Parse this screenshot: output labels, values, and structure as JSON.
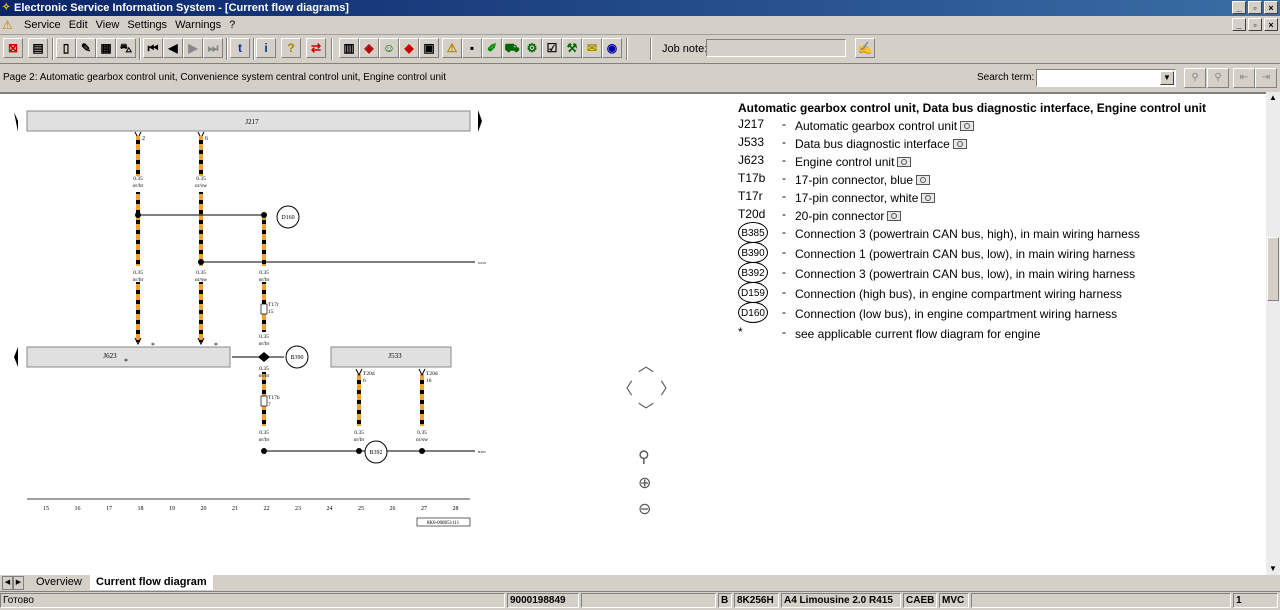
{
  "window": {
    "title": "Electronic Service Information System - [Current flow diagrams]",
    "buttons": [
      "_",
      "▫",
      "×"
    ]
  },
  "menu": {
    "items": [
      "Service",
      "Edit",
      "View",
      "Settings",
      "Warnings",
      "?"
    ]
  },
  "toolbar": {
    "job_note_label": "Job note:",
    "job_note_value": ""
  },
  "pagebar": {
    "page_text": "Page 2: Automatic gearbox control unit, Convenience system central control unit, Engine control unit",
    "search_label": "Search term:",
    "search_value": ""
  },
  "legend": {
    "heading": "Automatic gearbox control unit, Data bus diagnostic interface, Engine control unit",
    "rows": [
      {
        "code": "J217",
        "desc": "Automatic gearbox control unit",
        "photo": true
      },
      {
        "code": "J533",
        "desc": "Data bus diagnostic interface",
        "photo": true
      },
      {
        "code": "J623",
        "desc": "Engine control unit",
        "photo": true
      },
      {
        "code": "T17b",
        "desc": "17-pin connector, blue",
        "photo": true
      },
      {
        "code": "T17r",
        "desc": "17-pin connector, white",
        "photo": true
      },
      {
        "code": "T20d",
        "desc": "20-pin connector",
        "photo": true
      },
      {
        "code": "B385",
        "desc": "Connection 3 (powertrain CAN bus, high), in main wiring harness",
        "circle": true
      },
      {
        "code": "B390",
        "desc": "Connection 1 (powertrain CAN bus, low), in main wiring harness",
        "circle": true
      },
      {
        "code": "B392",
        "desc": "Connection 3 (powertrain CAN bus, low), in main wiring harness",
        "circle": true
      },
      {
        "code": "D159",
        "desc": "Connection (high bus), in engine compartment wiring harness",
        "circle": true
      },
      {
        "code": "D160",
        "desc": "Connection (low bus), in engine compartment wiring harness",
        "circle": true
      },
      {
        "code": "*",
        "desc": "see applicable current flow diagram for engine"
      }
    ]
  },
  "diagram": {
    "component_j217": "J217",
    "component_j623": "J623",
    "component_j533": "J533",
    "pin_2": "2",
    "pin_6": "6",
    "wire_gauge": "0.35",
    "wire_color_or_br": "or/br",
    "wire_color_or_sw": "or/sw",
    "conn_d160": "D160",
    "conn_b390": "B390",
    "conn_b392": "B392",
    "conn_t17r": "T17r",
    "conn_t17r_pin": "15",
    "conn_t17b": "T17b",
    "conn_t17b_pin": "7",
    "conn_t20d_a": "T20d",
    "conn_t20d_a_pin": "6",
    "conn_t20d_b": "T20d",
    "conn_t20d_b_pin": "16",
    "ref_d159": "D159",
    "ref_b385": "B385",
    "star": "*",
    "drawing_id": "8K0-008051111",
    "grid_numbers": [
      "15",
      "16",
      "17",
      "18",
      "19",
      "20",
      "21",
      "22",
      "23",
      "24",
      "25",
      "26",
      "27",
      "28"
    ]
  },
  "tabs": {
    "overview": "Overview",
    "current": "Current flow diagram"
  },
  "status": {
    "ready": "Готово",
    "order": "9000198849",
    "b": "B",
    "model_code": "8K256H",
    "model": "A4 Limousine 2.0 R415",
    "engine": "CAEB",
    "gearbox": "MVC",
    "page": "1"
  },
  "colors": {
    "wire_orange": "#f0a030",
    "wire_black": "#000000",
    "title_bar": "#0a246a"
  }
}
